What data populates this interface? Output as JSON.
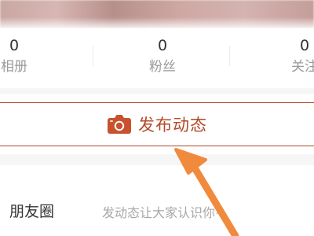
{
  "stats": [
    {
      "value": "0",
      "label": "相册"
    },
    {
      "value": "0",
      "label": "粉丝"
    },
    {
      "value": "0",
      "label": "关注"
    }
  ],
  "publish": {
    "label": "发布动态",
    "icon": "camera-icon",
    "color": "#b24a2a"
  },
  "moments": {
    "title": "朋友圈",
    "hint": "发动态让大家认识你~"
  },
  "annotation": {
    "arrow_color": "#f08a3c"
  }
}
